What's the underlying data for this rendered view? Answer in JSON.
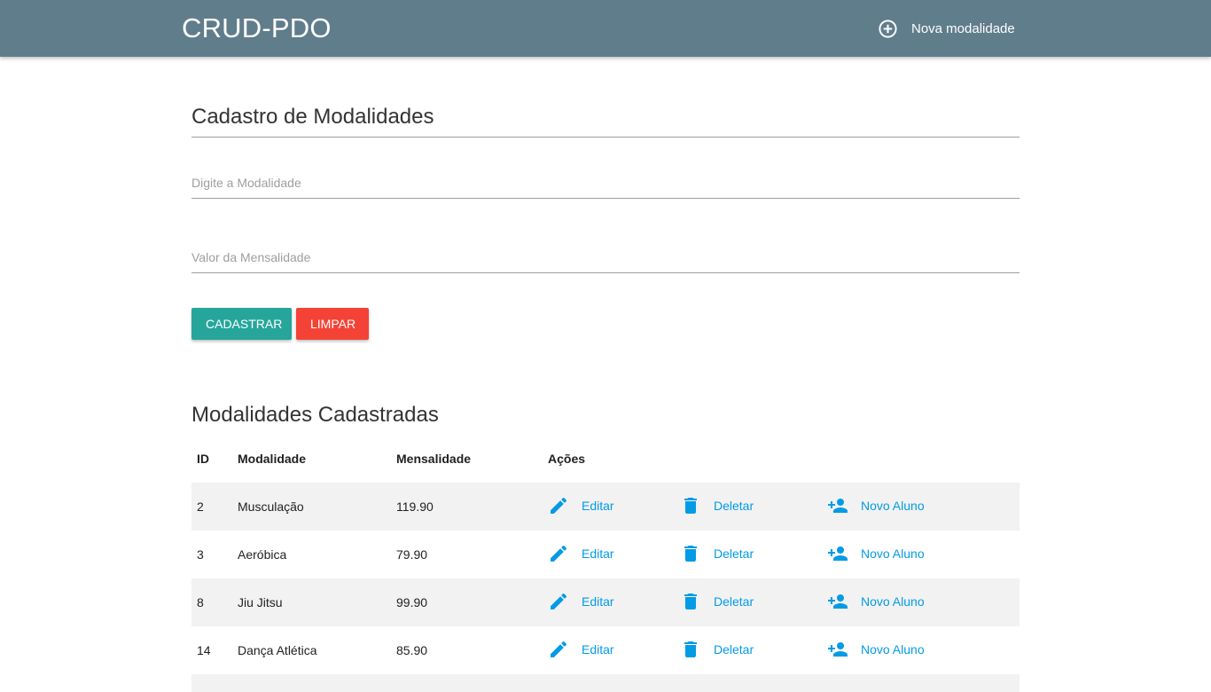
{
  "navbar": {
    "brand": "CRUD-PDO",
    "action_label": "Nova modalidade",
    "action_icon": "add-circle-outline-icon",
    "background": "#607d8b"
  },
  "form": {
    "title": "Cadastro de Modalidades",
    "modalidade_placeholder": "Digite a Modalidade",
    "modalidade_value": "",
    "mensalidade_placeholder": "Valor da Mensalidade",
    "mensalidade_value": "",
    "submit_label": "CADASTRAR",
    "clear_label": "LIMPAR",
    "submit_color": "#26a69a",
    "clear_color": "#f44336"
  },
  "list": {
    "title": "Modalidades Cadastradas",
    "headers": {
      "id": "ID",
      "modalidade": "Modalidade",
      "mensalidade": "Mensalidade",
      "acoes": "Ações"
    },
    "action_labels": {
      "edit": "Editar",
      "delete": "Deletar",
      "new_student": "Novo Aluno"
    },
    "action_color": "#039be5",
    "rows": [
      {
        "id": "2",
        "modalidade": "Musculação",
        "mensalidade": "119.90"
      },
      {
        "id": "3",
        "modalidade": "Aeróbica",
        "mensalidade": "79.90"
      },
      {
        "id": "8",
        "modalidade": "Jiu Jitsu",
        "mensalidade": "99.90"
      },
      {
        "id": "14",
        "modalidade": "Dança Atlética",
        "mensalidade": "85.90"
      }
    ]
  }
}
